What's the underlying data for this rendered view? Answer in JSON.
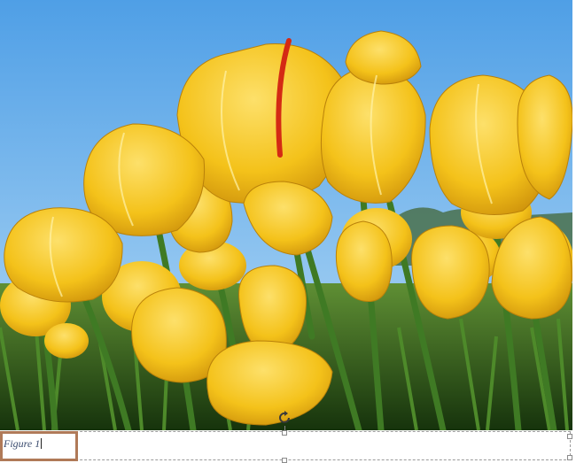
{
  "image": {
    "subject": "yellow-tulips-photo",
    "colors": {
      "sky": "#5fa9e6",
      "petal": "#f4c21a",
      "stem": "#3f7a24",
      "accent": "#d42a14"
    }
  },
  "caption": {
    "text": "Figure 1"
  },
  "handles": [
    "rotate-handle",
    "top-handle",
    "bottom-handle",
    "right-top-handle",
    "right-bottom-handle"
  ]
}
